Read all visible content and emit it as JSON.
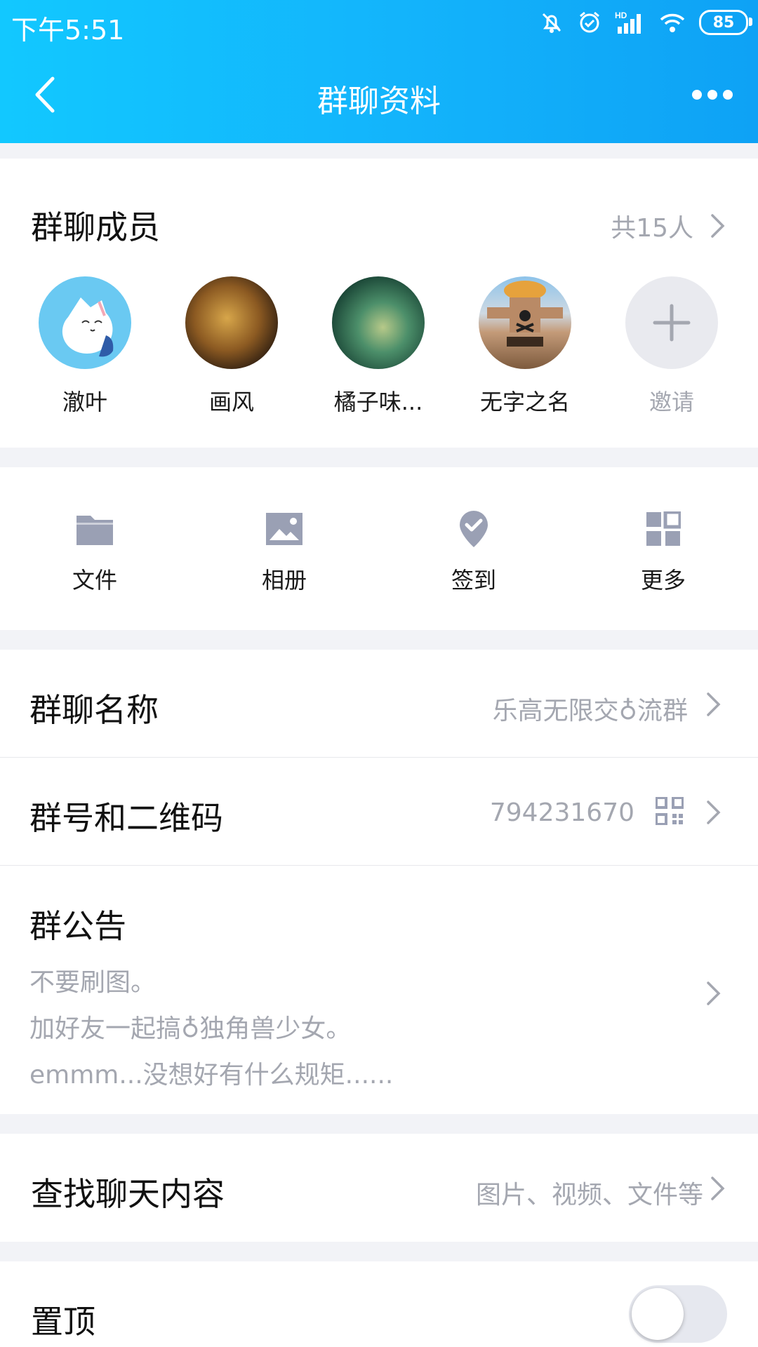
{
  "status_bar": {
    "time": "下午5:51",
    "battery": "85",
    "network": "HD"
  },
  "header": {
    "title": "群聊资料"
  },
  "members": {
    "title": "群聊成员",
    "count": "共15人",
    "list": [
      {
        "name": "澈叶"
      },
      {
        "name": "画风"
      },
      {
        "name": "橘子味..."
      },
      {
        "name": "无字之名"
      }
    ],
    "invite_label": "邀请"
  },
  "tools": [
    {
      "label": "文件",
      "icon": "folder-icon"
    },
    {
      "label": "相册",
      "icon": "image-icon"
    },
    {
      "label": "签到",
      "icon": "checkin-pin-icon"
    },
    {
      "label": "更多",
      "icon": "grid-icon"
    }
  ],
  "group_name": {
    "label": "群聊名称",
    "value": "乐高无限交♁流群"
  },
  "group_id": {
    "label": "群号和二维码",
    "value": "794231670"
  },
  "notice": {
    "label": "群公告",
    "lines": [
      "不要刷图。",
      "加好友一起搞♁独角兽少女。",
      "emmm...没想好有什么规矩......"
    ]
  },
  "search_chat": {
    "label": "查找聊天内容",
    "hint": "图片、视频、文件等"
  },
  "pin": {
    "label": "置顶",
    "enabled": false
  },
  "colors": {
    "header_start": "#12c8ff",
    "header_end": "#0ea2f5",
    "muted_text": "#a4a7b0",
    "icon_gray": "#9aa0b4"
  }
}
